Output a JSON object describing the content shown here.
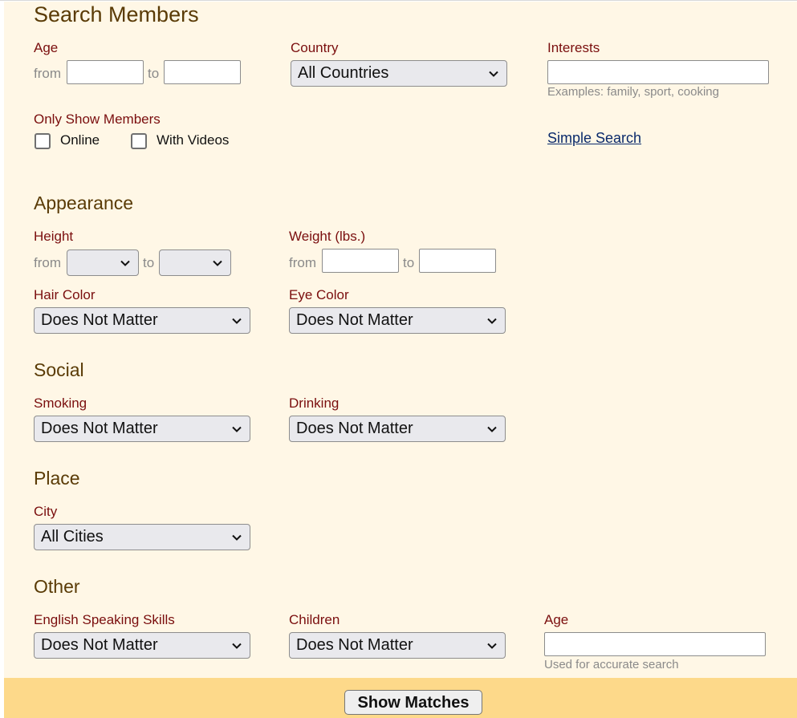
{
  "page": {
    "title": "Search Members"
  },
  "basic": {
    "age_label": "Age",
    "from": "from",
    "to": "to",
    "age_from_value": "",
    "age_to_value": "",
    "country_label": "Country",
    "country_value": "All Countries",
    "interests_label": "Interests",
    "interests_value": "",
    "interests_hint": "Examples: family, sport, cooking",
    "only_show_label": "Only Show Members",
    "online_label": "Online",
    "videos_label": "With Videos",
    "simple_search_link": "Simple Search"
  },
  "appearance": {
    "heading": "Appearance",
    "height_label": "Height",
    "height_from_value": "",
    "height_to_value": "",
    "weight_label": "Weight (lbs.)",
    "weight_from_value": "",
    "weight_to_value": "",
    "hair_label": "Hair Color",
    "hair_value": "Does Not Matter",
    "eye_label": "Eye Color",
    "eye_value": "Does Not Matter"
  },
  "social": {
    "heading": "Social",
    "smoking_label": "Smoking",
    "smoking_value": "Does Not Matter",
    "drinking_label": "Drinking",
    "drinking_value": "Does Not Matter"
  },
  "place": {
    "heading": "Place",
    "city_label": "City",
    "city_value": "All Cities"
  },
  "other": {
    "heading": "Other",
    "english_label": "English Speaking Skills",
    "english_value": "Does Not Matter",
    "children_label": "Children",
    "children_value": "Does Not Matter",
    "age_label": "Age",
    "age_value": "",
    "age_hint": "Used for accurate search"
  },
  "footer": {
    "submit_label": "Show Matches"
  },
  "icons": {
    "dropdown": "chevron-down-icon"
  },
  "colors": {
    "panel_bg": "#fff7e6",
    "footer_bg": "#fdd98a",
    "label": "#7a0e0e",
    "heading": "#5a3b06",
    "link": "#0a2a6b"
  }
}
